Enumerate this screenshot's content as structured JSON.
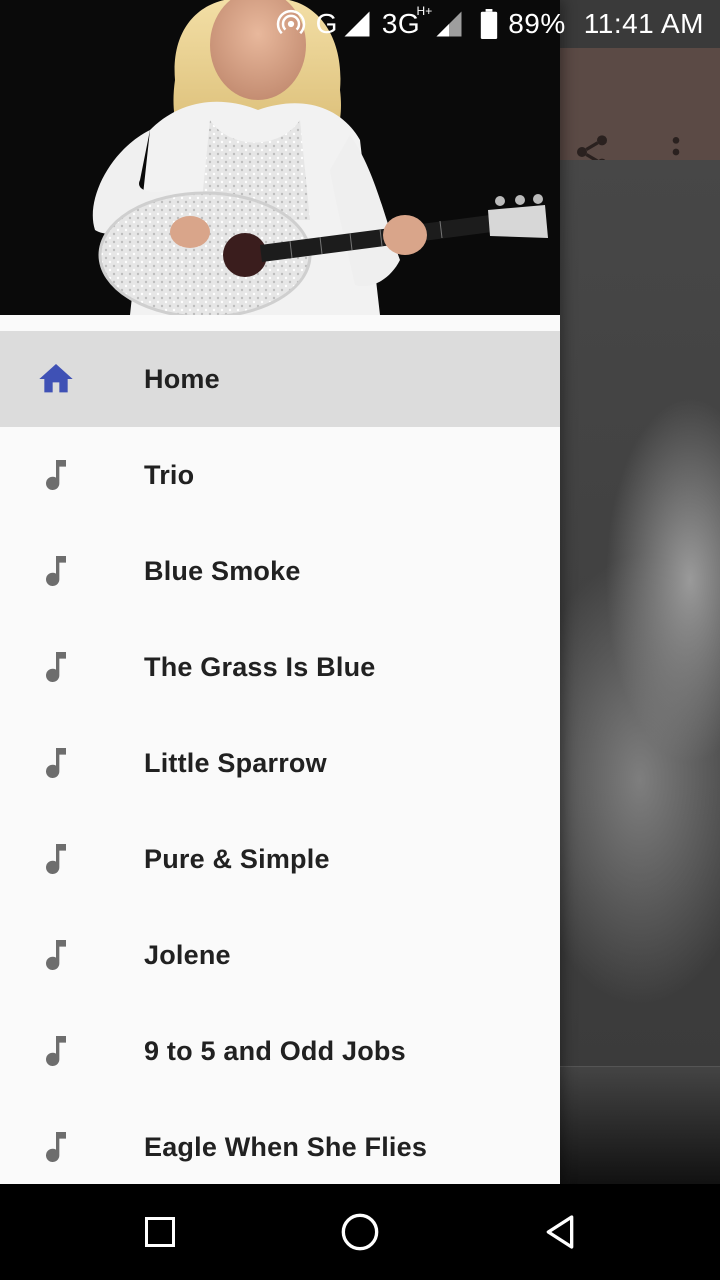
{
  "status_bar": {
    "network_g": "G",
    "network_3g": "3G",
    "network_hplus": "H+",
    "battery": "89%",
    "time": "11:41 AM",
    "icons": [
      "hotspot-icon",
      "signal-icon",
      "signal-icon",
      "battery-icon"
    ]
  },
  "toolbar": {
    "icons": [
      "share-icon",
      "more-vert-icon"
    ]
  },
  "drawer": {
    "header_image": "artist-with-guitar-photo",
    "items": [
      {
        "label": "Home",
        "icon": "home-icon",
        "active": true
      },
      {
        "label": "Trio",
        "icon": "music-note-icon"
      },
      {
        "label": "Blue Smoke",
        "icon": "music-note-icon"
      },
      {
        "label": "The Grass Is Blue",
        "icon": "music-note-icon"
      },
      {
        "label": "Little Sparrow",
        "icon": "music-note-icon"
      },
      {
        "label": "Pure & Simple",
        "icon": "music-note-icon"
      },
      {
        "label": "Jolene",
        "icon": "music-note-icon"
      },
      {
        "label": "9 to 5 and Odd Jobs",
        "icon": "music-note-icon"
      },
      {
        "label": "Eagle When She Flies",
        "icon": "music-note-icon"
      }
    ]
  },
  "nav_bar": {
    "icons": [
      "recents-icon",
      "home-circle-icon",
      "back-icon"
    ]
  },
  "colors": {
    "accent": "#3f51b5",
    "active_bg": "#dcdcdc",
    "drawer_bg": "#fafafa",
    "toolbar_bg": "#5b4a45",
    "icon_gray": "#6d6d6d"
  }
}
